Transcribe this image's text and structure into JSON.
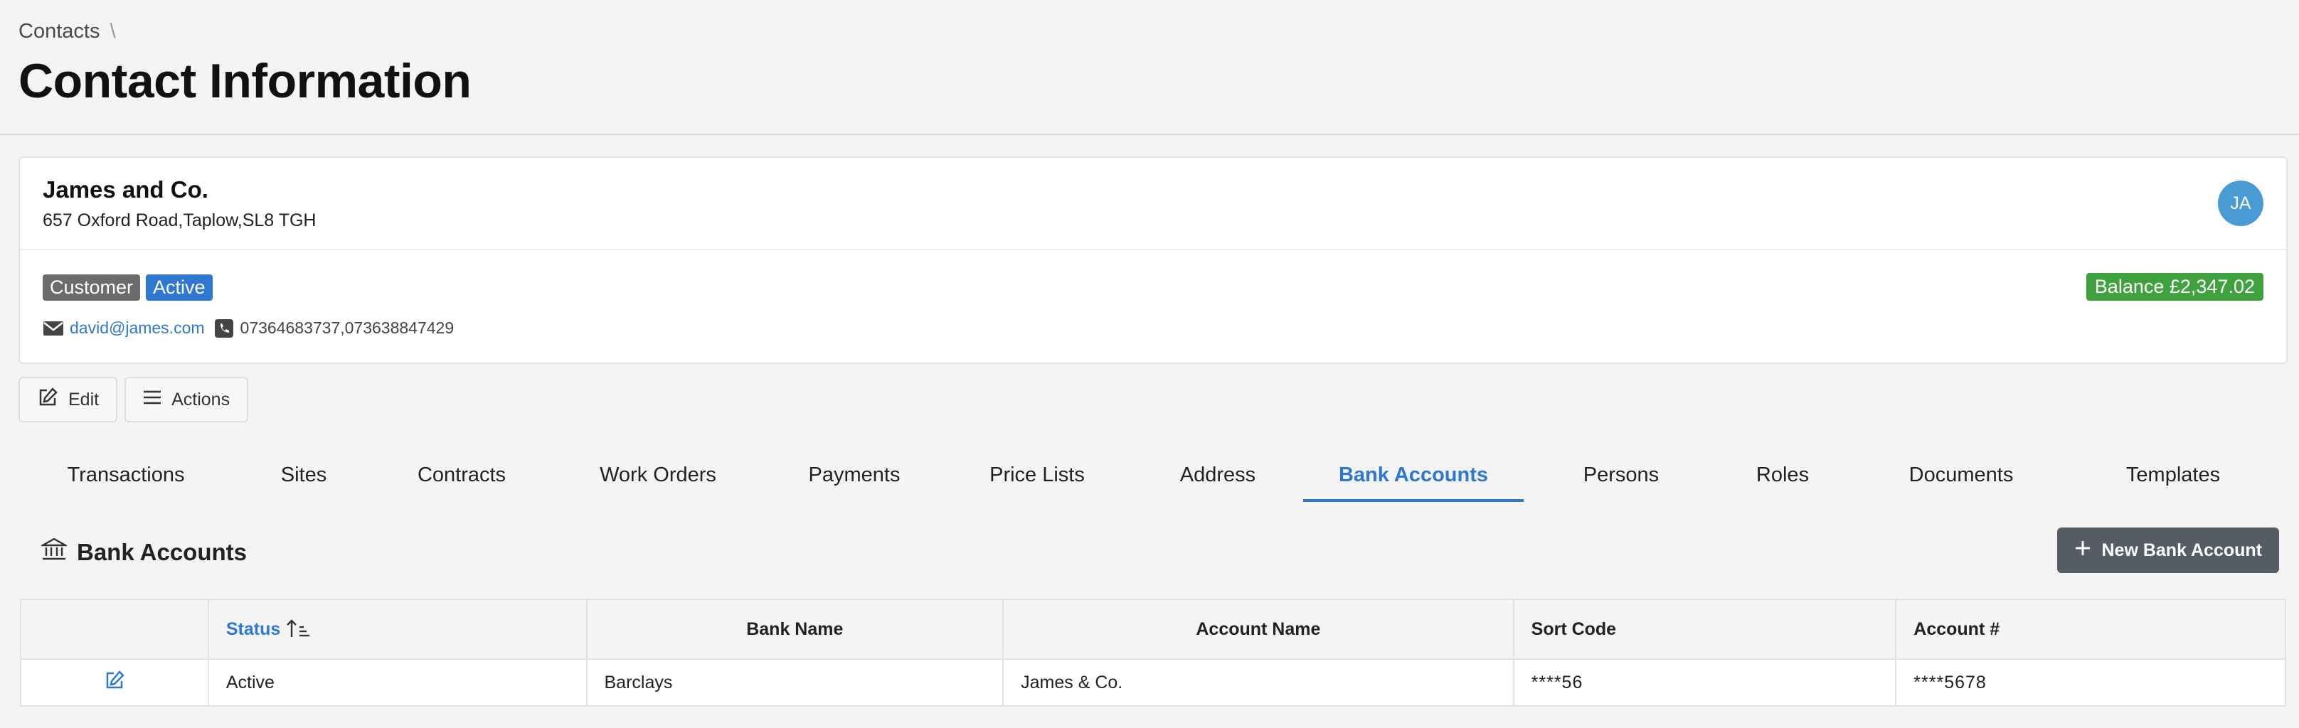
{
  "breadcrumb": {
    "root": "Contacts",
    "separator": "\\"
  },
  "page": {
    "title": "Contact Information"
  },
  "contact": {
    "name": "James and Co.",
    "address": "657 Oxford Road,Taplow,SL8 TGH",
    "avatar_initials": "JA",
    "badges": {
      "type": "Customer",
      "status": "Active"
    },
    "balance": "Balance £2,347.02",
    "email": "david@james.com",
    "phones": "07364683737,073638847429"
  },
  "toolbar": {
    "edit_label": "Edit",
    "actions_label": "Actions"
  },
  "tabs": [
    {
      "label": "Transactions",
      "active": false
    },
    {
      "label": "Sites",
      "active": false
    },
    {
      "label": "Contracts",
      "active": false
    },
    {
      "label": "Work Orders",
      "active": false
    },
    {
      "label": "Payments",
      "active": false
    },
    {
      "label": "Price Lists",
      "active": false
    },
    {
      "label": "Address",
      "active": false
    },
    {
      "label": "Bank Accounts",
      "active": true
    },
    {
      "label": "Persons",
      "active": false
    },
    {
      "label": "Roles",
      "active": false
    },
    {
      "label": "Documents",
      "active": false
    },
    {
      "label": "Templates",
      "active": false
    }
  ],
  "bank_section": {
    "title": "Bank Accounts",
    "new_button": "New Bank Account"
  },
  "table": {
    "columns": [
      "",
      "Status",
      "Bank Name",
      "Account Name",
      "Sort Code",
      "Account #"
    ],
    "rows": [
      {
        "status": "Active",
        "bank_name": "Barclays",
        "account_name": "James & Co.",
        "sort_code": "****56",
        "account_no": "****5678"
      }
    ]
  },
  "colors": {
    "accent": "#2f78d1",
    "success": "#3fa23f",
    "avatar": "#4a9ad4",
    "dark_button": "#555c66"
  }
}
